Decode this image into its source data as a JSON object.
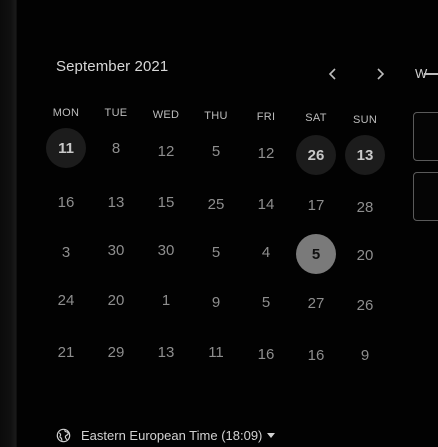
{
  "calendar": {
    "month_title": "September 2021",
    "next_label": "W",
    "weekdays": [
      "MON",
      "TUE",
      "WED",
      "THU",
      "FRI",
      "SAT",
      "SUN"
    ],
    "weeks": [
      [
        "11",
        "8",
        "12",
        "5",
        "12",
        "26",
        "13"
      ],
      [
        "16",
        "13",
        "15",
        "25",
        "14",
        "17",
        "28"
      ],
      [
        "3",
        "30",
        "30",
        "5",
        "4",
        "5",
        "20"
      ],
      [
        "24",
        "20",
        "1",
        "9",
        "5",
        "27",
        "26"
      ],
      [
        "21",
        "29",
        "13",
        "11",
        "16",
        "16",
        "9"
      ]
    ],
    "available_days": [
      "11",
      "26",
      "13"
    ],
    "selected_day": "5"
  },
  "timezone": {
    "label": "Eastern European Time (18:09)"
  },
  "icons": {
    "prev": "chevron-left-icon",
    "next": "chevron-right-icon",
    "timezone": "globe-icon",
    "dropdown": "caret-down-icon"
  },
  "colors": {
    "background": "#020202",
    "available_circle": "#1c1c1c",
    "selected_circle": "#7a7a7a"
  }
}
